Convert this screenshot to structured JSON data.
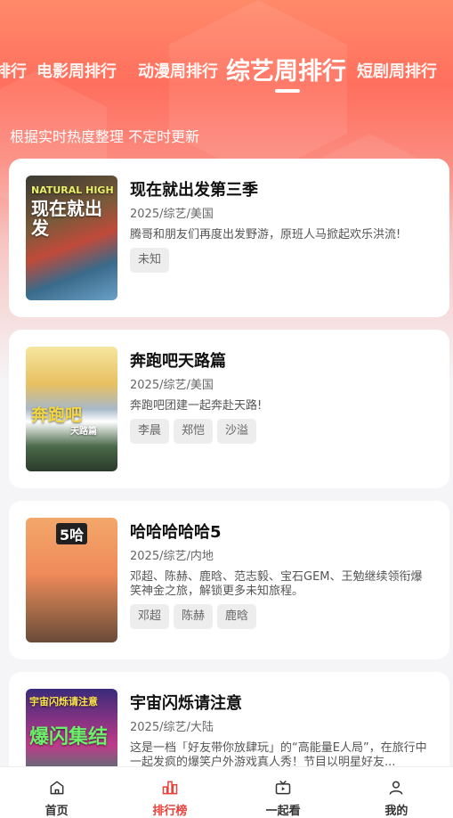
{
  "tabs": [
    {
      "label": "排行"
    },
    {
      "label": "电影周排行"
    },
    {
      "label": "动漫周排行"
    },
    {
      "label": "综艺周排行"
    },
    {
      "label": "短剧周排行"
    }
  ],
  "subtitle": "根据实时热度整理 不定时更新",
  "items": [
    {
      "title": "现在就出发第三季",
      "meta": "2025/综艺/美国",
      "desc": "腾哥和朋友们再度出发野游，原班人马掀起欢乐洪流!",
      "tags": [
        "未知"
      ],
      "poster_text": "现在就出发",
      "poster_sub": "NATURAL HIGH"
    },
    {
      "title": "奔跑吧天路篇",
      "meta": "2025/综艺/美国",
      "desc": "奔跑吧团建一起奔赴天路!",
      "tags": [
        "李晨",
        "郑恺",
        "沙溢"
      ],
      "poster_text": "奔跑吧",
      "poster_sub": "天路篇"
    },
    {
      "title": "哈哈哈哈哈5",
      "meta": "2025/综艺/内地",
      "desc": "邓超、陈赫、鹿晗、范志毅、宝石GEM、王勉继续领衔爆笑神金之旅，解锁更多未知旅程。",
      "tags": [
        "邓超",
        "陈赫",
        "鹿晗"
      ],
      "poster_text": "5哈"
    },
    {
      "title": "宇宙闪烁请注意",
      "meta": "2025/综艺/大陆",
      "desc": "这是一档「好友带你放肆玩」的“高能量E人局”，在旅行中一起发疯的爆笑户外游戏真人秀！节目以明星好友...",
      "tags": [],
      "poster_text": "爆闪集结",
      "poster_sub": "宇宙闪烁请注意"
    }
  ],
  "nav": [
    {
      "label": "首页"
    },
    {
      "label": "排行榜"
    },
    {
      "label": "一起看"
    },
    {
      "label": "我的"
    }
  ],
  "colors": {
    "accent": "#e8403a",
    "hero_top": "#ff6f5d"
  }
}
